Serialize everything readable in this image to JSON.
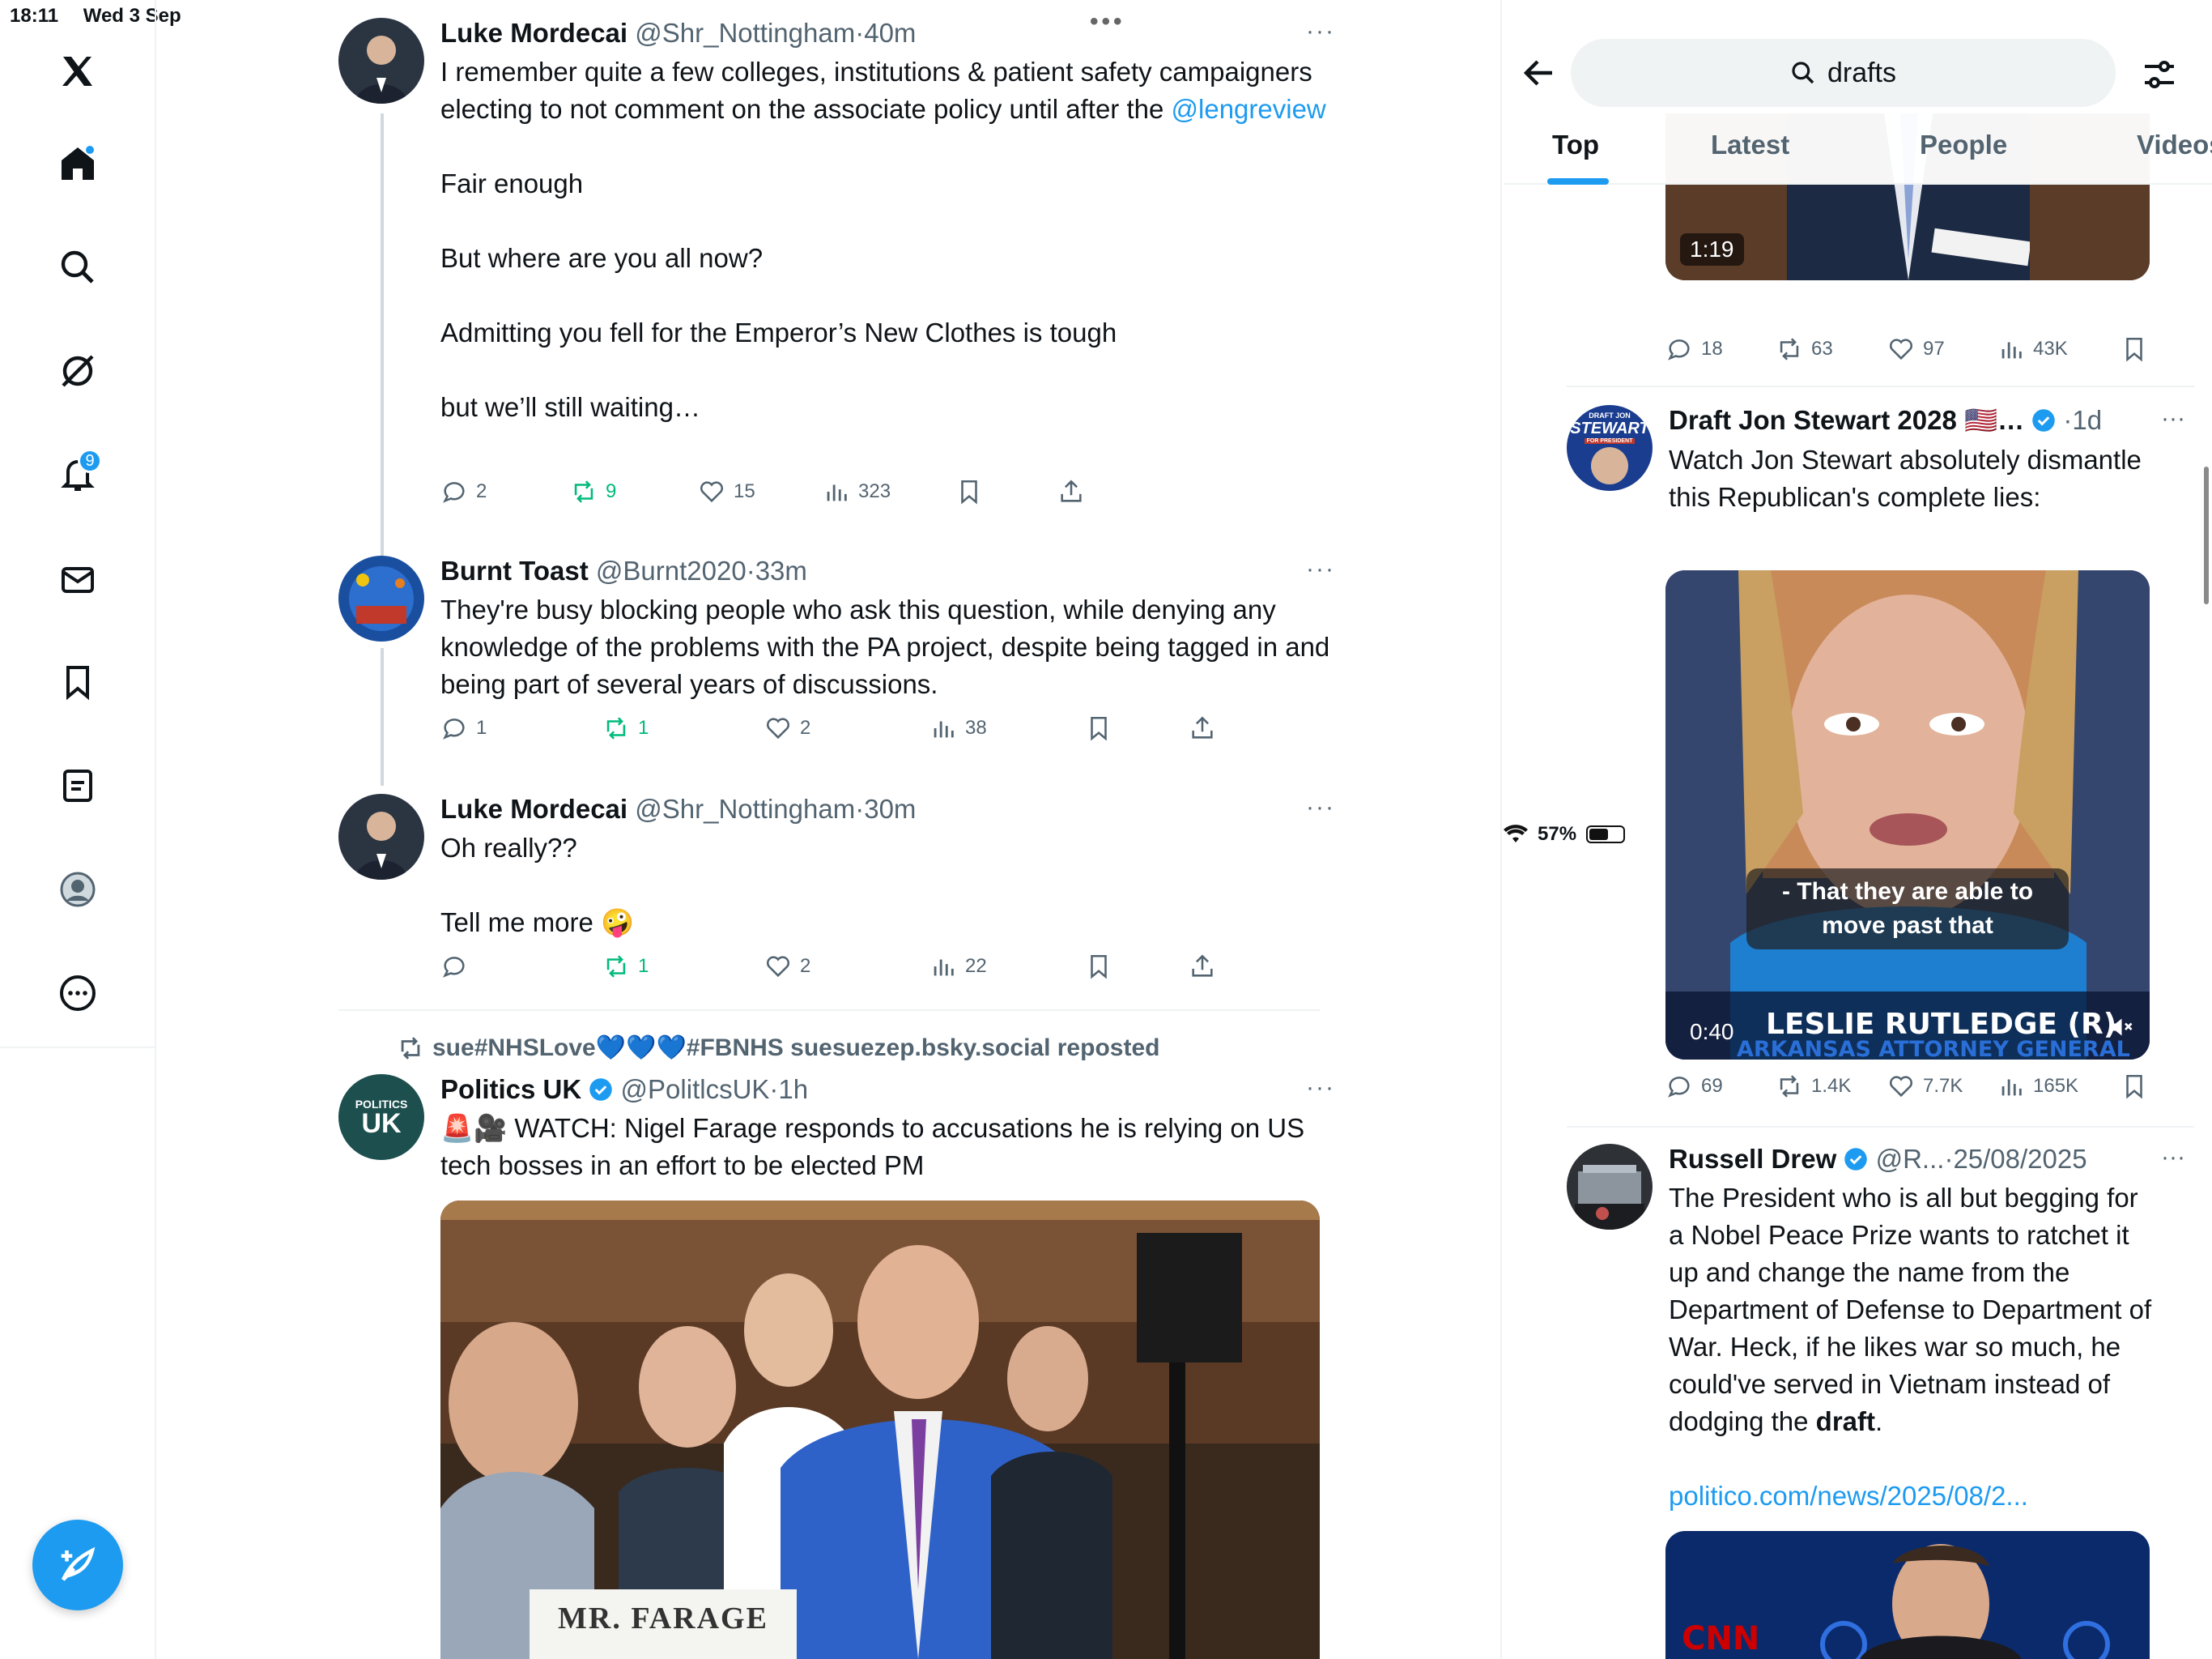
{
  "status": {
    "time": "18:11",
    "date": "Wed 3 Sep",
    "battery": "57%",
    "battery_level": 0.57
  },
  "nav": {
    "items": [
      "x-logo",
      "home",
      "search",
      "grok",
      "notifications",
      "messages",
      "bookmarks",
      "lists",
      "profile",
      "more"
    ],
    "notifications_badge": "9",
    "compose_label": "Post"
  },
  "timeline": {
    "tweets": [
      {
        "name": "Luke Mordecai",
        "handle": "@Shr_Nottingham",
        "sep": "·",
        "time": "40m",
        "text_before_link": "I remember quite a few colleges, institutions & patient safety campaigners electing to not comment on the associate policy until after the ",
        "link": "@lengreview",
        "text_after": "\n\nFair enough\n\nBut where are you all now?\n\nAdmitting you fell for the Emperor’s New Clothes is tough\n\nbut we’ll still waiting…",
        "replies": "2",
        "reposts": "9",
        "likes": "15",
        "views": "323"
      },
      {
        "name": "Burnt Toast",
        "handle": "@Burnt2020",
        "sep": "·",
        "time": "33m",
        "text": "They're busy blocking people who ask this question, while denying any knowledge of the problems with the PA project, despite being tagged in and being part of several years of discussions.",
        "replies": "1",
        "reposts": "1",
        "likes": "2",
        "views": "38"
      },
      {
        "name": "Luke Mordecai",
        "handle": "@Shr_Nottingham",
        "sep": "·",
        "time": "30m",
        "text": "Oh really??\n\nTell me more 🤪",
        "replies": "",
        "reposts": "1",
        "likes": "2",
        "views": "22"
      }
    ],
    "repost_line": "sue#NHSLove💙💙💙#FBNHS suesuezep.bsky.social reposted",
    "politics": {
      "name": "Politics UK",
      "handle": "@PolitlcsUK",
      "sep": "·",
      "time": "1h",
      "avatar_text_top": "POLITICS",
      "avatar_text_bottom": "UK",
      "text": "🚨🎥 WATCH: Nigel Farage responds to accusations he is relying on US tech bosses in an effort to be elected PM",
      "media_caption": "MR. FARAGE"
    }
  },
  "right": {
    "search_query": "drafts",
    "tabs": [
      "Top",
      "Latest",
      "People",
      "Videos"
    ],
    "active_tab": "Top",
    "video1": {
      "duration": "1:19",
      "replies": "18",
      "reposts": "63",
      "likes": "97",
      "views": "43K"
    },
    "draft": {
      "name": "Draft Jon Stewart 2028",
      "flag": "🇺🇸",
      "ellipsis": "…",
      "sep": "·",
      "time": "1d",
      "text": "Watch Jon Stewart absolutely dismantle this Republican's complete lies:",
      "avatar_top": "DRAFT JON",
      "avatar_mid": "STEWART",
      "avatar_bottom": "FOR PRESIDENT",
      "subtitle_line1": "- That they are able to",
      "subtitle_line2": "move past that",
      "lower_third_name": "LESLIE RUTLEDGE (R)",
      "lower_third_title": "ARKANSAS ATTORNEY GENERAL",
      "duration": "0:40",
      "replies": "69",
      "reposts": "1.4K",
      "likes": "7.7K",
      "views": "165K"
    },
    "russell": {
      "name": "Russell Drew",
      "handle": "@R...",
      "sep": "·",
      "time": "25/08/2025",
      "text_before_bold": "The President who is all but begging for a Nobel Peace Prize wants to ratchet it up and change the name from the Department of Defense to Department of War. Heck, if he likes war so much, he could've served in Vietnam instead of dodging the ",
      "bold": "draft",
      "text_after_bold": ".",
      "link": "politico.com/news/2025/08/2...",
      "media_logo": "CNN"
    }
  },
  "colors": {
    "accent": "#1d9bf0",
    "repost_green": "#00ba7c",
    "muted": "#536471"
  }
}
